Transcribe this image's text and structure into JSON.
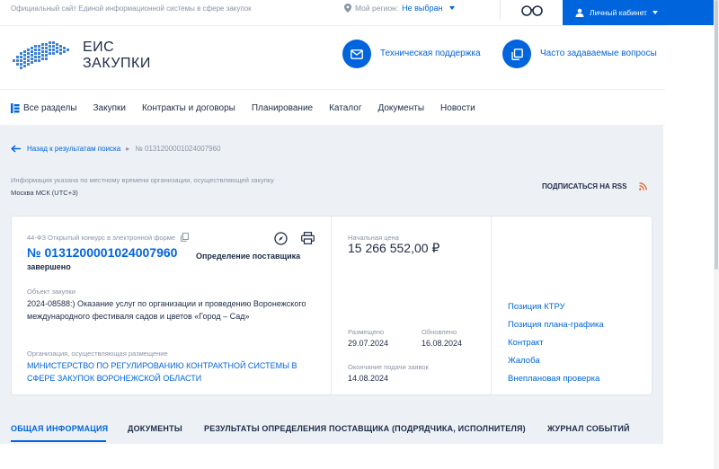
{
  "topbar": {
    "description": "Официальный сайт Единой информационной системы в сфере закупок",
    "region_label": "Мой регион:",
    "region_value": "Не выбран",
    "cabinet_label": "Личный кабинет"
  },
  "header": {
    "logo_line1": "ЕИС",
    "logo_line2": "ЗАКУПКИ",
    "support_label": "Техническая поддержка",
    "faq_label": "Часто задаваемые вопросы"
  },
  "nav": {
    "all_sections": "Все разделы",
    "items": [
      "Закупки",
      "Контракты и договоры",
      "Планирование",
      "Каталог",
      "Документы",
      "Новости"
    ]
  },
  "breadcrumb": {
    "back_label": "Назад к результатам поиска",
    "separator": "▸",
    "current": "№ 0131200001024007960"
  },
  "info": {
    "note": "Информация указана по местному времени организации, осуществляющей закупку",
    "timezone": "Москва МСК (UTC+3)",
    "rss_label": "ПОДПИСАТЬСЯ НА RSS"
  },
  "card": {
    "law_type": "44-ФЗ Открытый конкурс в электронной форме",
    "reg_number": "№ 0131200001024007960",
    "status_line1": "Определение поставщика",
    "status_line2": "завершено",
    "object_label": "Объект закупки",
    "object_text": "2024-08588:) Оказание услуг по организации и проведению Воронежского международного фестиваля садов и цветов «Город – Сад»",
    "org_label": "Организация, осуществляющая размещение",
    "org_name": "МИНИСТЕРСТВО ПО РЕГУЛИРОВАНИЮ КОНТРАКТНОЙ СИСТЕМЫ В СФЕРЕ ЗАКУПОК ВОРОНЕЖСКОЙ ОБЛАСТИ",
    "price_label": "Начальная цена",
    "price_value": "15 266 552,00 ₽",
    "posted_label": "Размещено",
    "posted_value": "29.07.2024",
    "updated_label": "Обновлено",
    "updated_value": "16.08.2024",
    "deadline_label": "Окончание подачи заявок",
    "deadline_value": "14.08.2024",
    "links": [
      "Позиция КТРУ",
      "Позиция плана-графика",
      "Контракт",
      "Жалоба",
      "Внеплановая проверка"
    ]
  },
  "tabs": [
    "ОБЩАЯ ИНФОРМАЦИЯ",
    "ДОКУМЕНТЫ",
    "РЕЗУЛЬТАТЫ ОПРЕДЕЛЕНИЯ ПОСТАВЩИКА (ПОДРЯДЧИКА, ИСПОЛНИТЕЛЯ)",
    "ЖУРНАЛ СОБЫТИЙ"
  ],
  "colors": {
    "accent": "#0065dd",
    "background_grey": "#edf1f6",
    "rss": "#e8622c"
  }
}
